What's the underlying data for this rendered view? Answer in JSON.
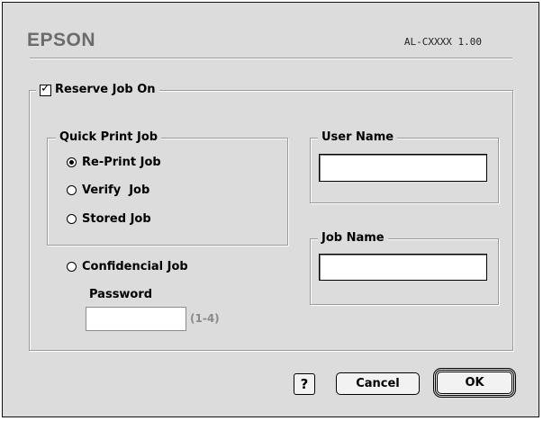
{
  "brand": "EPSON",
  "model": "AL-CXXXX 1.00",
  "reserve": {
    "label": "Reserve Job On",
    "checked": true
  },
  "quick_print": {
    "title": "Quick Print Job",
    "options": [
      {
        "label": "Re-Print Job",
        "selected": true
      },
      {
        "label": "Verify  Job",
        "selected": false
      },
      {
        "label": "Stored Job",
        "selected": false
      }
    ]
  },
  "confidential": {
    "label": "Confidencial Job",
    "selected": false
  },
  "password": {
    "label": "Password",
    "value": "",
    "range": "(1-4)"
  },
  "user_name": {
    "label": "User Name",
    "value": ""
  },
  "job_name": {
    "label": "Job Name",
    "value": ""
  },
  "buttons": {
    "help": "?",
    "cancel": "Cancel",
    "ok": "OK"
  }
}
